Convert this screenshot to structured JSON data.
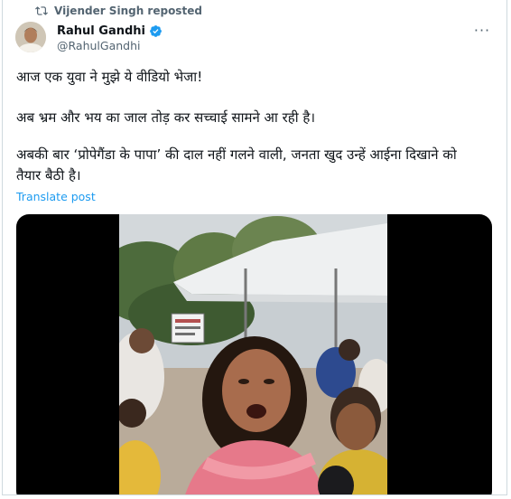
{
  "repost": {
    "label": "Vijender Singh reposted",
    "icon": "repost-icon"
  },
  "author": {
    "name": "Rahul Gandhi",
    "handle": "@RahulGandhi",
    "verified_color": "#1d9bf0"
  },
  "more_label": "···",
  "post": {
    "line1": "आज एक युवा ने मुझे ये वीडियो भेजा!",
    "line2": "अब भ्रम और भय का जाल तोड़ कर सच्चाई सामने आ रही है।",
    "line3a": "अबकी बार ‘प्रोपेगैंडा के पापा’ की दाल नहीं गलने वाली, जनता खुद उन्हें आईना दिखाने को",
    "line3b": "तैयार बैठी है।"
  },
  "translate_label": "Translate post",
  "colors": {
    "accent": "#1d9bf0",
    "secondary_text": "#536471",
    "primary_text": "#0f1419"
  }
}
